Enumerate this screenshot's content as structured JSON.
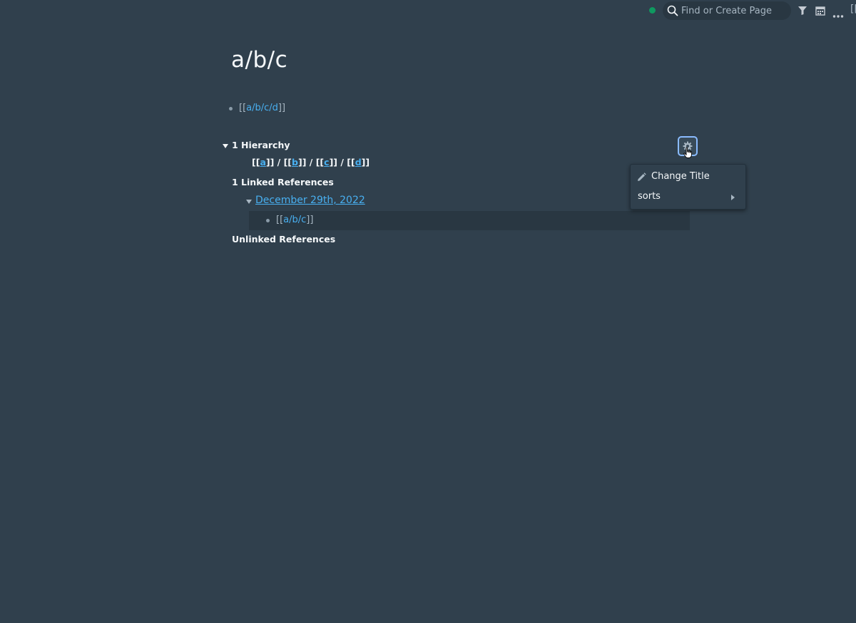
{
  "topbar": {
    "search_placeholder": "Find or Create Page",
    "icons": [
      "search-icon",
      "filter-icon",
      "calendar-icon",
      "more-icon"
    ],
    "edge_glyph": "[[",
    "sync_color": "#0f9960"
  },
  "page": {
    "title": "a/b/c",
    "blocks": [
      {
        "open": "[[",
        "link": "a/b/c/d",
        "close": "]]"
      }
    ]
  },
  "hierarchy": {
    "heading": "1 Hierarchy",
    "segments": [
      {
        "open": "[[",
        "link": "a",
        "close": "]]"
      },
      {
        "sep": " / "
      },
      {
        "open": "[[",
        "link": "b",
        "close": "]]"
      },
      {
        "sep": " / "
      },
      {
        "open": "[[",
        "link": "c",
        "close": "]]"
      },
      {
        "sep": " / "
      },
      {
        "open": "[[",
        "link": "d",
        "close": "]]"
      }
    ]
  },
  "linked_refs": {
    "heading": "1 Linked References",
    "page": "December 29th, 2022",
    "block": {
      "open": "[[",
      "link": "a/b/c",
      "close": "]]"
    }
  },
  "unlinked_refs": {
    "heading": "Unlinked References"
  },
  "menu": {
    "items": [
      {
        "label": "Change Title",
        "icon": "pencil-icon"
      },
      {
        "label": "sorts",
        "has_submenu": true
      }
    ]
  },
  "colors": {
    "background": "#30404d",
    "link": "#48aff0",
    "focus_ring": "#8abbff"
  }
}
